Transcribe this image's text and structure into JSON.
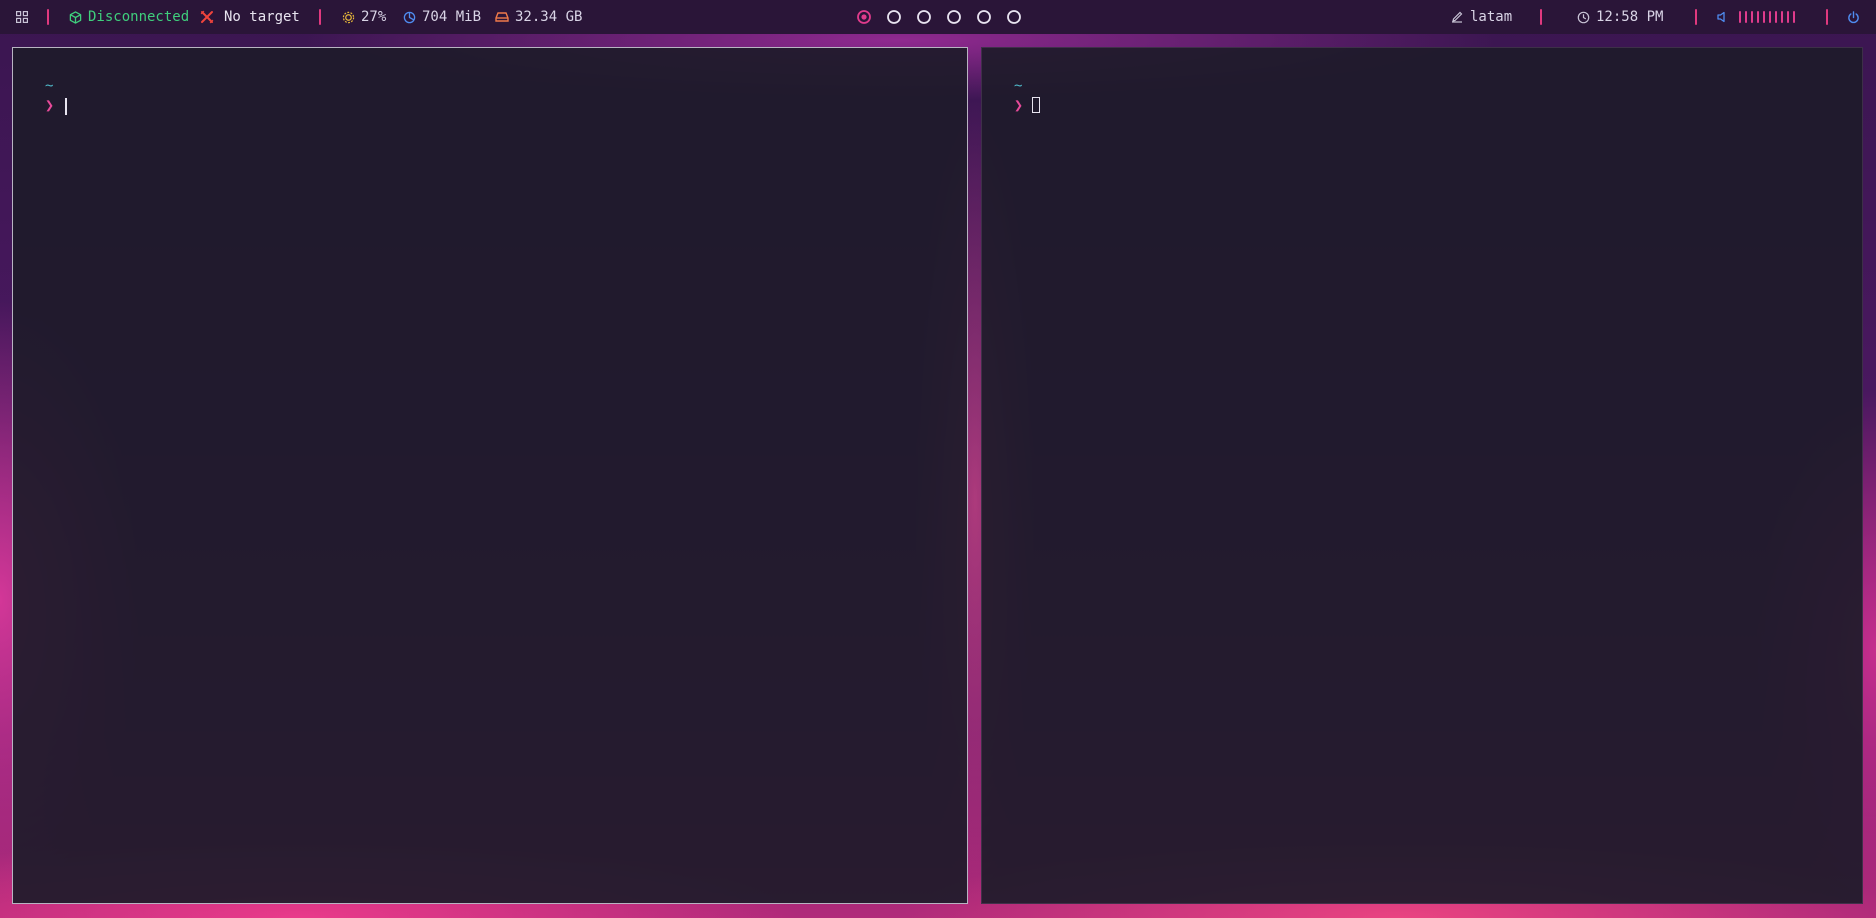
{
  "topbar": {
    "menu_icon": "grid-icon",
    "vpn": {
      "icon": "cube-icon",
      "label": "Disconnected",
      "color": "#3fce7c"
    },
    "target": {
      "icon": "cross-icon",
      "label": "No target",
      "color": "#f0443c"
    },
    "cpu": {
      "icon": "cpu-icon",
      "label": "27%",
      "color": "#e8b93a"
    },
    "memory": {
      "icon": "pie-icon",
      "label": "704 MiB",
      "color": "#4f8cf0"
    },
    "disk": {
      "icon": "drive-icon",
      "label": "32.34 GB",
      "color": "#f07a4a"
    },
    "workspaces": [
      {
        "name": "workspace-1",
        "active": true
      },
      {
        "name": "workspace-2",
        "active": false
      },
      {
        "name": "workspace-3",
        "active": false
      },
      {
        "name": "workspace-4",
        "active": false
      },
      {
        "name": "workspace-5",
        "active": false
      },
      {
        "name": "workspace-6",
        "active": false
      }
    ],
    "keyboard": {
      "icon": "pencil-icon",
      "label": "latam"
    },
    "clock": {
      "icon": "clock-icon",
      "label": "12:58 PM"
    },
    "volume": {
      "icon": "speaker-icon",
      "level_bars": 10
    },
    "power_icon": "power-icon",
    "accent": "#e0397f"
  },
  "terminals": [
    {
      "cwd": "~",
      "prompt": "❯",
      "focused": true
    },
    {
      "cwd": "~",
      "prompt": "❯",
      "focused": false
    }
  ]
}
